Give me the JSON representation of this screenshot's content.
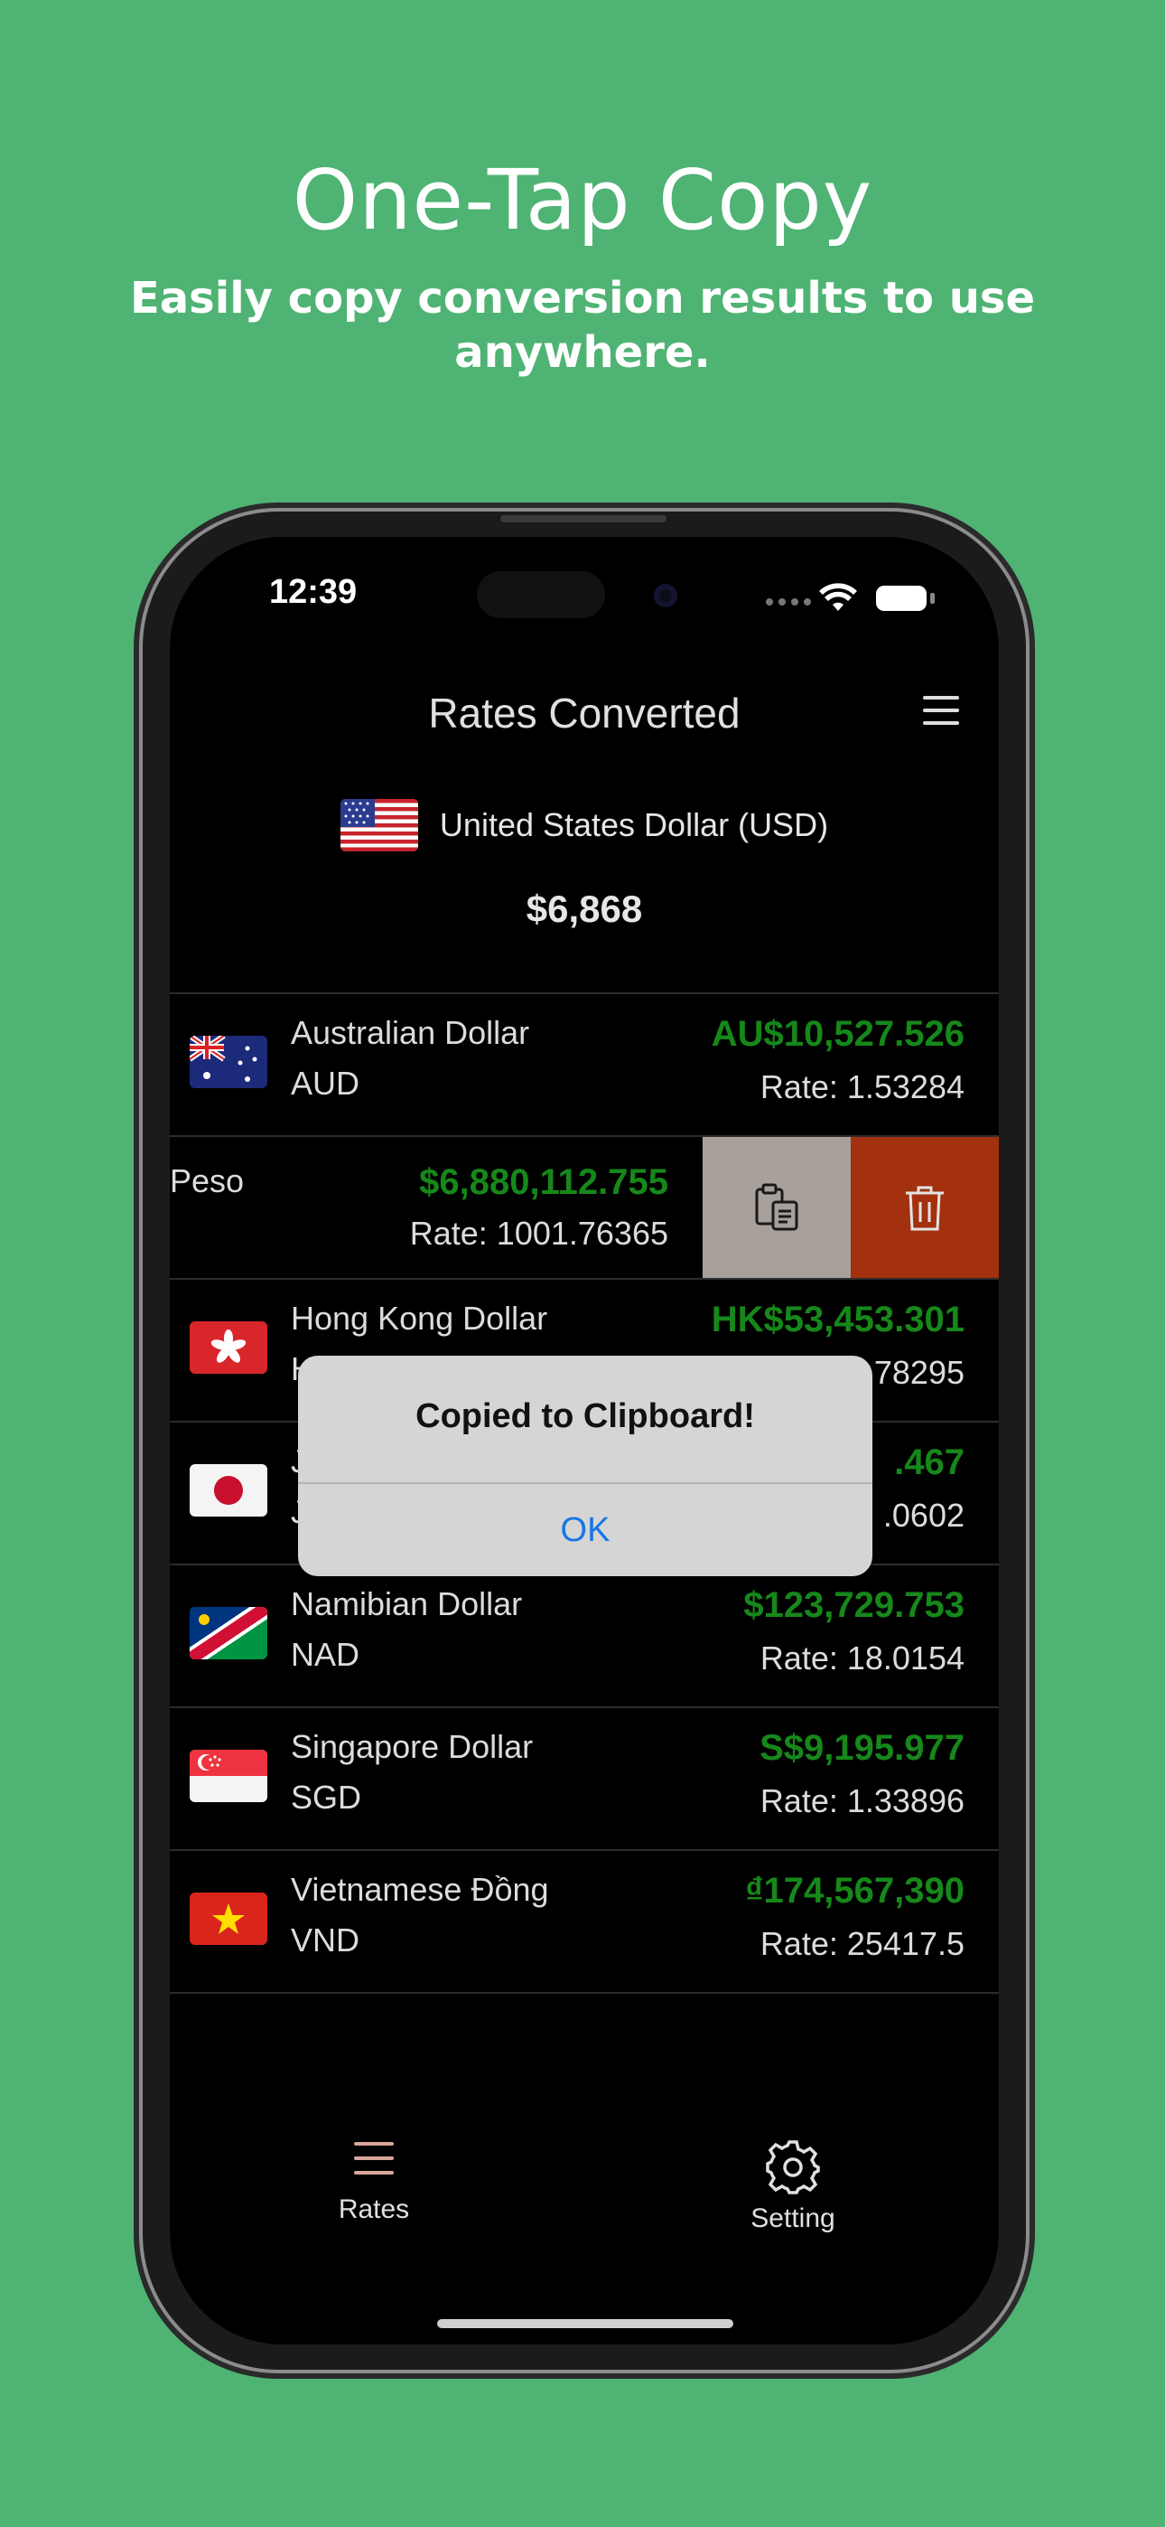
{
  "promo": {
    "headline": "One-Tap Copy",
    "subhead": "Easily copy conversion results to use anywhere."
  },
  "status_bar": {
    "time": "12:39"
  },
  "nav": {
    "title": "Rates Converted",
    "menu_icon": "hamburger-menu-icon"
  },
  "base": {
    "flag": "us-flag",
    "name": "United States Dollar (USD)",
    "amount": "$6,868"
  },
  "rows": [
    {
      "flag": "au-flag",
      "name": "Australian Dollar",
      "code": "AUD",
      "amount": "AU$10,527.526",
      "rate": "Rate: 1.53284"
    },
    {
      "flag": "",
      "name": "Peso",
      "code": "",
      "amount": "$6,880,112.755",
      "rate": "Rate: 1001.76365"
    },
    {
      "flag": "hk-flag",
      "name": "Hong Kong Dollar",
      "code": "H",
      "amount": "HK$53,453.301",
      "rate": "78295"
    },
    {
      "flag": "jp-flag",
      "name": "J",
      "code": "J",
      "amount": ".467",
      "rate": ".0602"
    },
    {
      "flag": "na-flag",
      "name": "Namibian Dollar",
      "code": "NAD",
      "amount": "$123,729.753",
      "rate": "Rate: 18.0154"
    },
    {
      "flag": "sg-flag",
      "name": "Singapore Dollar",
      "code": "SGD",
      "amount": "S$9,195.977",
      "rate": "Rate: 1.33896"
    },
    {
      "flag": "vn-flag",
      "name": "Vietnamese Đồng",
      "code": "VND",
      "amount": "₫174,567,390",
      "rate": "Rate: 25417.5"
    }
  ],
  "swipe_actions": {
    "copy_icon": "clipboard-icon",
    "delete_icon": "trash-icon"
  },
  "alert": {
    "title": "Copied to Clipboard!",
    "ok_label": "OK"
  },
  "tabs": [
    {
      "label": "Rates",
      "icon": "list-icon"
    },
    {
      "label": "Setting",
      "icon": "gear-icon"
    }
  ],
  "colors": {
    "background": "#4fb374",
    "amount_green": "#16881a",
    "copy_action": "#a8a09b",
    "delete_action": "#a3300f",
    "alert_ok_blue": "#1676e6",
    "rates_tab_icon": "#d9a79a"
  }
}
